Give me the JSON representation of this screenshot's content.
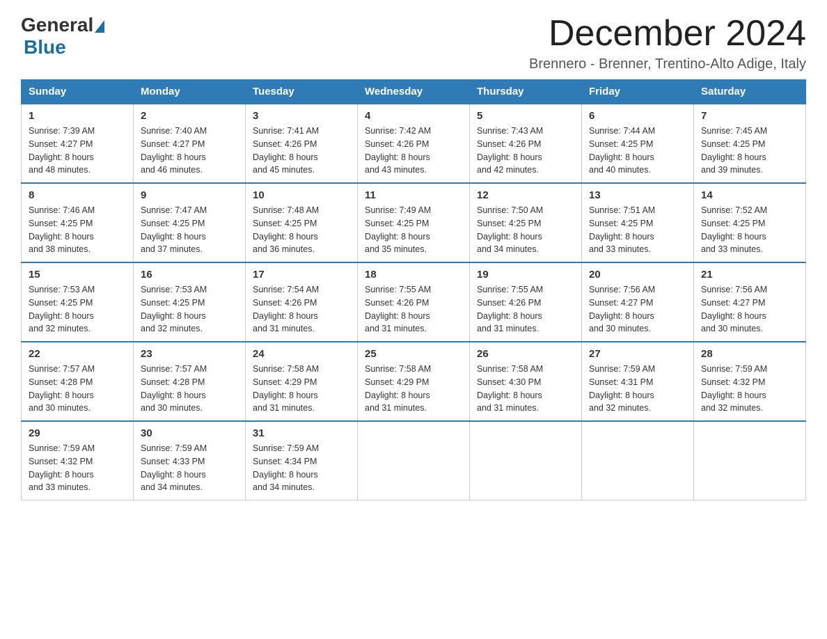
{
  "logo": {
    "general": "General",
    "blue": "Blue"
  },
  "title": "December 2024",
  "location": "Brennero - Brenner, Trentino-Alto Adige, Italy",
  "weekdays": [
    "Sunday",
    "Monday",
    "Tuesday",
    "Wednesday",
    "Thursday",
    "Friday",
    "Saturday"
  ],
  "weeks": [
    [
      {
        "day": "1",
        "sunrise": "7:39 AM",
        "sunset": "4:27 PM",
        "daylight": "8 hours and 48 minutes."
      },
      {
        "day": "2",
        "sunrise": "7:40 AM",
        "sunset": "4:27 PM",
        "daylight": "8 hours and 46 minutes."
      },
      {
        "day": "3",
        "sunrise": "7:41 AM",
        "sunset": "4:26 PM",
        "daylight": "8 hours and 45 minutes."
      },
      {
        "day": "4",
        "sunrise": "7:42 AM",
        "sunset": "4:26 PM",
        "daylight": "8 hours and 43 minutes."
      },
      {
        "day": "5",
        "sunrise": "7:43 AM",
        "sunset": "4:26 PM",
        "daylight": "8 hours and 42 minutes."
      },
      {
        "day": "6",
        "sunrise": "7:44 AM",
        "sunset": "4:25 PM",
        "daylight": "8 hours and 40 minutes."
      },
      {
        "day": "7",
        "sunrise": "7:45 AM",
        "sunset": "4:25 PM",
        "daylight": "8 hours and 39 minutes."
      }
    ],
    [
      {
        "day": "8",
        "sunrise": "7:46 AM",
        "sunset": "4:25 PM",
        "daylight": "8 hours and 38 minutes."
      },
      {
        "day": "9",
        "sunrise": "7:47 AM",
        "sunset": "4:25 PM",
        "daylight": "8 hours and 37 minutes."
      },
      {
        "day": "10",
        "sunrise": "7:48 AM",
        "sunset": "4:25 PM",
        "daylight": "8 hours and 36 minutes."
      },
      {
        "day": "11",
        "sunrise": "7:49 AM",
        "sunset": "4:25 PM",
        "daylight": "8 hours and 35 minutes."
      },
      {
        "day": "12",
        "sunrise": "7:50 AM",
        "sunset": "4:25 PM",
        "daylight": "8 hours and 34 minutes."
      },
      {
        "day": "13",
        "sunrise": "7:51 AM",
        "sunset": "4:25 PM",
        "daylight": "8 hours and 33 minutes."
      },
      {
        "day": "14",
        "sunrise": "7:52 AM",
        "sunset": "4:25 PM",
        "daylight": "8 hours and 33 minutes."
      }
    ],
    [
      {
        "day": "15",
        "sunrise": "7:53 AM",
        "sunset": "4:25 PM",
        "daylight": "8 hours and 32 minutes."
      },
      {
        "day": "16",
        "sunrise": "7:53 AM",
        "sunset": "4:25 PM",
        "daylight": "8 hours and 32 minutes."
      },
      {
        "day": "17",
        "sunrise": "7:54 AM",
        "sunset": "4:26 PM",
        "daylight": "8 hours and 31 minutes."
      },
      {
        "day": "18",
        "sunrise": "7:55 AM",
        "sunset": "4:26 PM",
        "daylight": "8 hours and 31 minutes."
      },
      {
        "day": "19",
        "sunrise": "7:55 AM",
        "sunset": "4:26 PM",
        "daylight": "8 hours and 31 minutes."
      },
      {
        "day": "20",
        "sunrise": "7:56 AM",
        "sunset": "4:27 PM",
        "daylight": "8 hours and 30 minutes."
      },
      {
        "day": "21",
        "sunrise": "7:56 AM",
        "sunset": "4:27 PM",
        "daylight": "8 hours and 30 minutes."
      }
    ],
    [
      {
        "day": "22",
        "sunrise": "7:57 AM",
        "sunset": "4:28 PM",
        "daylight": "8 hours and 30 minutes."
      },
      {
        "day": "23",
        "sunrise": "7:57 AM",
        "sunset": "4:28 PM",
        "daylight": "8 hours and 30 minutes."
      },
      {
        "day": "24",
        "sunrise": "7:58 AM",
        "sunset": "4:29 PM",
        "daylight": "8 hours and 31 minutes."
      },
      {
        "day": "25",
        "sunrise": "7:58 AM",
        "sunset": "4:29 PM",
        "daylight": "8 hours and 31 minutes."
      },
      {
        "day": "26",
        "sunrise": "7:58 AM",
        "sunset": "4:30 PM",
        "daylight": "8 hours and 31 minutes."
      },
      {
        "day": "27",
        "sunrise": "7:59 AM",
        "sunset": "4:31 PM",
        "daylight": "8 hours and 32 minutes."
      },
      {
        "day": "28",
        "sunrise": "7:59 AM",
        "sunset": "4:32 PM",
        "daylight": "8 hours and 32 minutes."
      }
    ],
    [
      {
        "day": "29",
        "sunrise": "7:59 AM",
        "sunset": "4:32 PM",
        "daylight": "8 hours and 33 minutes."
      },
      {
        "day": "30",
        "sunrise": "7:59 AM",
        "sunset": "4:33 PM",
        "daylight": "8 hours and 34 minutes."
      },
      {
        "day": "31",
        "sunrise": "7:59 AM",
        "sunset": "4:34 PM",
        "daylight": "8 hours and 34 minutes."
      },
      null,
      null,
      null,
      null
    ]
  ]
}
